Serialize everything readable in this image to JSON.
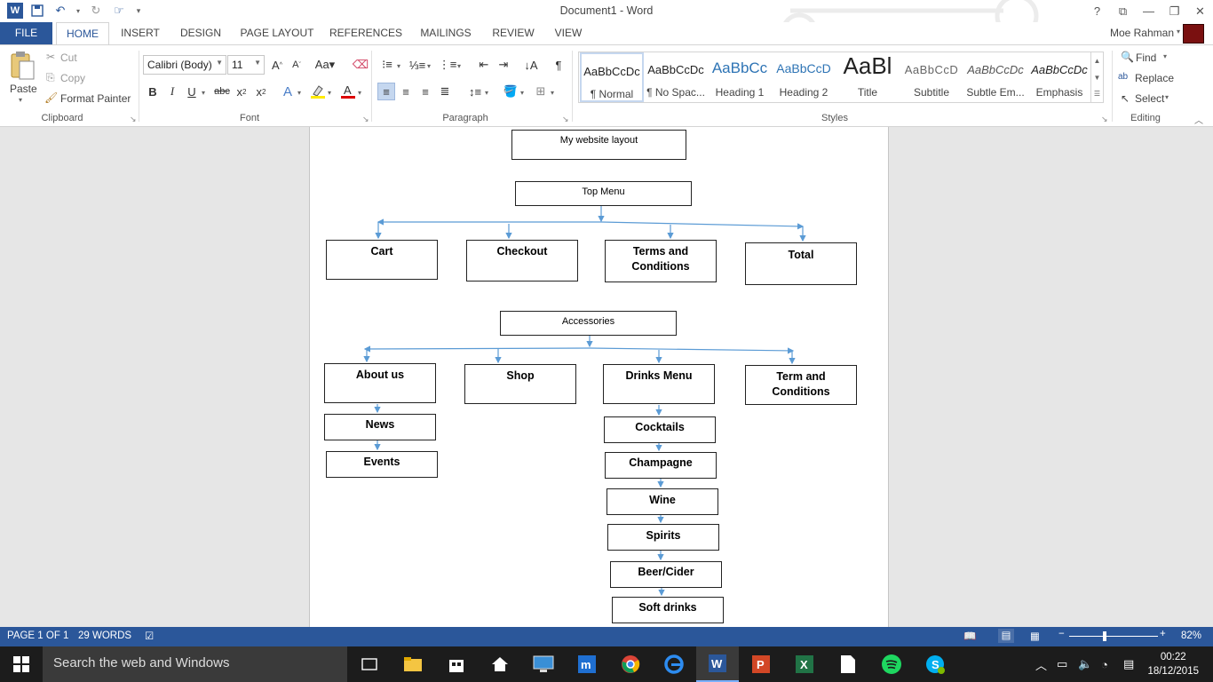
{
  "window": {
    "title": "Document1 - Word",
    "help": "?"
  },
  "tabs": [
    "FILE",
    "HOME",
    "INSERT",
    "DESIGN",
    "PAGE LAYOUT",
    "REFERENCES",
    "MAILINGS",
    "REVIEW",
    "VIEW"
  ],
  "user": {
    "name": "Moe Rahman"
  },
  "clipboard": {
    "paste": "Paste",
    "cut": "Cut",
    "copy": "Copy",
    "format_painter": "Format Painter",
    "label": "Clipboard"
  },
  "font": {
    "family": "Calibri (Body)",
    "size": "11",
    "label": "Font"
  },
  "paragraph": {
    "label": "Paragraph"
  },
  "styles": {
    "label": "Styles",
    "items": [
      {
        "sample": "AaBbCcDc",
        "name": "¶ Normal"
      },
      {
        "sample": "AaBbCcDc",
        "name": "¶ No Spac..."
      },
      {
        "sample": "AaBbCc",
        "name": "Heading 1"
      },
      {
        "sample": "AaBbCcD",
        "name": "Heading 2"
      },
      {
        "sample": "AaBl",
        "name": "Title"
      },
      {
        "sample": "AaBbCcD",
        "name": "Subtitle"
      },
      {
        "sample": "AaBbCcDc",
        "name": "Subtle Em..."
      },
      {
        "sample": "AaBbCcDc",
        "name": "Emphasis"
      }
    ]
  },
  "editing": {
    "find": "Find",
    "replace": "Replace",
    "select": "Select",
    "label": "Editing"
  },
  "diagram": {
    "title_box": "My website layout",
    "top_menu": "Top Menu",
    "top_items": [
      "Cart",
      "Checkout",
      "Terms and Conditions",
      "Total"
    ],
    "accessories": "Accessories",
    "acc_items": [
      "About us",
      "Shop",
      "Drinks Menu",
      "Term and Conditions"
    ],
    "about_children": [
      "News",
      "Events"
    ],
    "drinks_children": [
      "Cocktails",
      "Champagne",
      "Wine",
      "Spirits",
      "Beer/Cider",
      "Soft drinks"
    ]
  },
  "status": {
    "page": "PAGE 1 OF 1",
    "words": "29 WORDS",
    "zoom": "82%"
  },
  "taskbar": {
    "search_placeholder": "Search the web and Windows",
    "time": "00:22",
    "date": "18/12/2015"
  }
}
